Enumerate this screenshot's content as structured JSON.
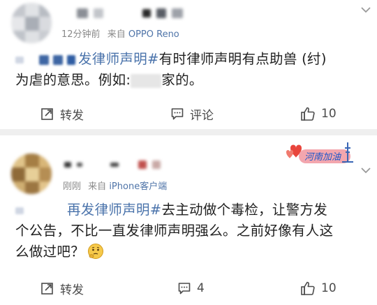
{
  "posts": [
    {
      "meta": {
        "time": "12分钟前",
        "source_prefix": "来自",
        "device": "OPPO Reno"
      },
      "text": {
        "tag": "发律师声明#",
        "body1": "有时律师声明有点助兽 (纣)",
        "body2_a": "为虐的意思。例如:",
        "body2_b": "家的。"
      },
      "actions": {
        "repost": "转发",
        "comment": "评论",
        "like": "10"
      }
    },
    {
      "meta": {
        "time": "刚刚",
        "source_prefix": "来自",
        "device": "iPhone客户端"
      },
      "text": {
        "tag": "再发律师声明#",
        "body1": "去主动做个毒检，让警方发",
        "body2": "个公告，不比一直发律师声明强么。之前好像有人这",
        "body3": "么做过吧？"
      },
      "actions": {
        "repost": "转发",
        "comment": "4",
        "like": "10"
      }
    }
  ],
  "badge": {
    "text": "河南加油"
  },
  "colors": {
    "link": "#4a73ab",
    "meta": "#8a8a8a",
    "separator": "#efefef"
  }
}
